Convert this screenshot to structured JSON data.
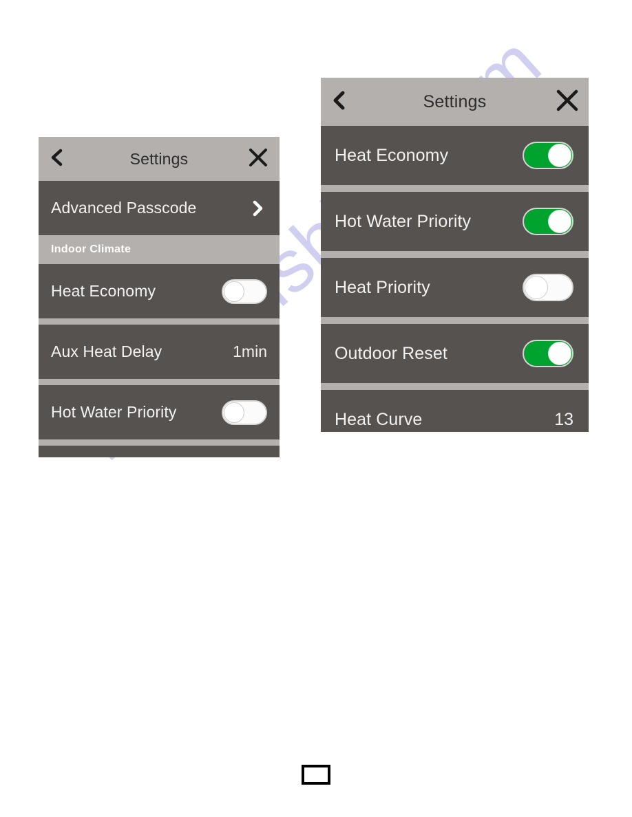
{
  "watermark": {
    "text": "manualshive.com"
  },
  "colors": {
    "panel_background": "#555250",
    "header_background": "#b3b0ae",
    "separator": "#b3b0ae",
    "row_text": "#f2f2f2",
    "header_text": "#2c2c2c",
    "toggle_on": "#00a32e",
    "toggle_off": "#fbfbfb",
    "page_box_border": "#000000"
  },
  "left_panel": {
    "header": {
      "title": "Settings",
      "back_icon": "chevron-left-icon",
      "close_icon": "close-x-icon"
    },
    "rows": [
      {
        "type": "link",
        "label": "Advanced Passcode",
        "accessory": "chevron-right-icon"
      },
      {
        "type": "section",
        "label": "Indoor Climate"
      },
      {
        "type": "toggle",
        "label": "Heat Economy",
        "state": "off"
      },
      {
        "type": "value",
        "label": "Aux Heat Delay",
        "value": "1min"
      },
      {
        "type": "toggle",
        "label": "Hot Water Priority",
        "state": "off"
      },
      {
        "type": "toggle-partial",
        "label": "",
        "state": "off"
      }
    ]
  },
  "right_panel": {
    "header": {
      "title": "Settings",
      "back_icon": "chevron-left-icon",
      "close_icon": "close-x-icon"
    },
    "rows": [
      {
        "type": "toggle",
        "label": "Heat Economy",
        "state": "on"
      },
      {
        "type": "toggle",
        "label": "Hot Water Priority",
        "state": "on"
      },
      {
        "type": "toggle",
        "label": "Heat Priority",
        "state": "off"
      },
      {
        "type": "toggle",
        "label": "Outdoor Reset",
        "state": "on"
      },
      {
        "type": "value",
        "label": "Heat Curve",
        "value": "13"
      }
    ]
  }
}
